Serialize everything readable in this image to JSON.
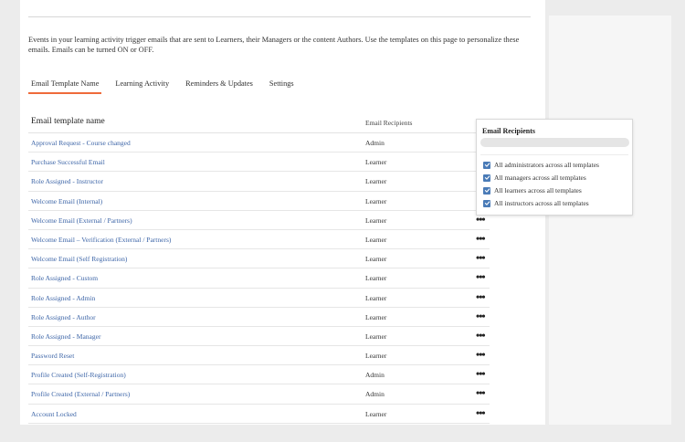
{
  "description": "Events in your learning activity trigger emails that are sent to Learners, their Managers or the content Authors. Use the templates on this page to personalize these emails. Emails can be turned ON or OFF.",
  "tabs": [
    {
      "label": "Email Template Name",
      "active": true
    },
    {
      "label": "Learning Activity",
      "active": false
    },
    {
      "label": "Reminders & Updates",
      "active": false
    },
    {
      "label": "Settings",
      "active": false
    }
  ],
  "table": {
    "headers": {
      "name": "Email template name",
      "recipients": "Email Recipients"
    },
    "rows": [
      {
        "name": "Approval Request - Course changed",
        "recipient": "Admin",
        "more": ""
      },
      {
        "name": "Purchase Successful Email",
        "recipient": "Learner",
        "more": ""
      },
      {
        "name": "Role Assigned - Instructor",
        "recipient": "Learner",
        "more": ""
      },
      {
        "name": "Welcome Email (Internal)",
        "recipient": "Learner",
        "more": ""
      },
      {
        "name": "Welcome Email (External / Partners)",
        "recipient": "Learner",
        "more": "•••"
      },
      {
        "name": "Welcome Email – Verification (External / Partners)",
        "recipient": "Learner",
        "more": "•••"
      },
      {
        "name": "Welcome Email (Self Registration)",
        "recipient": "Learner",
        "more": "•••"
      },
      {
        "name": "Role Assigned - Custom",
        "recipient": "Learner",
        "more": "•••"
      },
      {
        "name": "Role Assigned - Admin",
        "recipient": "Learner",
        "more": "•••"
      },
      {
        "name": "Role Assigned - Author",
        "recipient": "Learner",
        "more": "•••"
      },
      {
        "name": "Role Assigned - Manager",
        "recipient": "Learner",
        "more": "•••"
      },
      {
        "name": "Password Reset",
        "recipient": "Learner",
        "more": "•••"
      },
      {
        "name": "Profile Created (Self-Registration)",
        "recipient": "Admin",
        "more": "•••"
      },
      {
        "name": "Profile Created (External / Partners)",
        "recipient": "Admin",
        "more": "•••"
      },
      {
        "name": "Account Locked",
        "recipient": "Learner",
        "more": "•••"
      }
    ]
  },
  "popover": {
    "title": "Email Recipients",
    "search_placeholder": "",
    "options": [
      {
        "label": "All administrators across all templates",
        "checked": true
      },
      {
        "label": "All managers across all templates",
        "checked": true
      },
      {
        "label": "All learners across all templates",
        "checked": true
      },
      {
        "label": "All instructors across all templates",
        "checked": true
      }
    ]
  },
  "colors": {
    "accent_tab_underline": "#ef6a3a",
    "link": "#3e66a8",
    "checkbox": "#4a7bb7"
  }
}
